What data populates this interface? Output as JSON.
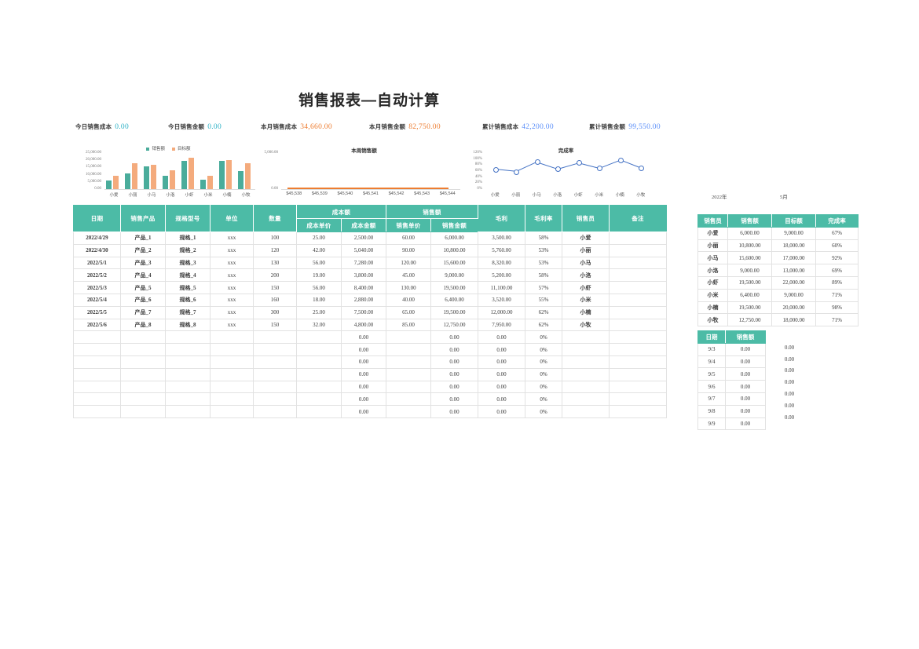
{
  "title": "销售报表—自动计算",
  "kpis": [
    {
      "label": "今日销售成本",
      "value": "0.00",
      "color": "#2ab0c5"
    },
    {
      "label": "今日销售金额",
      "value": "0.00",
      "color": "#2ab0c5"
    },
    {
      "label": "本月销售成本",
      "value": "34,660.00",
      "color": "#ed7d31"
    },
    {
      "label": "本月销售金额",
      "value": "82,750.00",
      "color": "#ed7d31"
    },
    {
      "label": "累计销售成本",
      "value": "42,200.00",
      "color": "#5b8ff9"
    },
    {
      "label": "累计销售金额",
      "value": "99,550.00",
      "color": "#5b8ff9"
    }
  ],
  "period": {
    "year": "2022年",
    "month": "5月"
  },
  "colors": {
    "header_teal": "#4cbba6",
    "series_sales": "#4aac9b",
    "series_target": "#f4ab7d",
    "series_rate": "#4472c4",
    "week_line": "#ed7d31"
  },
  "chart_data": [
    {
      "type": "bar",
      "id": "bar-chart",
      "title": "",
      "legend": [
        "销售额",
        "目标额"
      ],
      "legend_position": "top",
      "categories": [
        "小爱",
        "小丽",
        "小马",
        "小洛",
        "小虾",
        "小米",
        "小楠",
        "小牧"
      ],
      "series": [
        {
          "name": "销售额",
          "values": [
            6000,
            10800,
            15600,
            9000,
            19500,
            6400,
            19500,
            12750
          ]
        },
        {
          "name": "目标额",
          "values": [
            9000,
            18000,
            17000,
            13000,
            22000,
            9000,
            20000,
            18000
          ]
        }
      ],
      "ylim": [
        0,
        25000
      ],
      "yticks": [
        "0.00",
        "5,000.00",
        "10,000.00",
        "15,000.00",
        "20,000.00",
        "25,000.00"
      ],
      "xlabel": "",
      "ylabel": "",
      "grid": false
    },
    {
      "type": "line",
      "id": "week-chart",
      "title": "本周销售额",
      "categories": [
        "$45,538",
        "$45,539",
        "$45,540",
        "$45,541",
        "$45,542",
        "$45,543",
        "$45,544"
      ],
      "series": [
        {
          "name": "本周销售额",
          "values": [
            0,
            0,
            0,
            0,
            0,
            0,
            0
          ]
        }
      ],
      "ylim": [
        0,
        5000
      ],
      "yticks": [
        "0.00",
        "5,000.00"
      ],
      "xlabel": "",
      "ylabel": "",
      "grid": false
    },
    {
      "type": "line",
      "id": "rate-chart",
      "title": "完成率",
      "categories": [
        "小爱",
        "小丽",
        "小马",
        "小洛",
        "小虾",
        "小米",
        "小楠",
        "小牧"
      ],
      "series": [
        {
          "name": "完成率",
          "values": [
            67,
            60,
            92,
            69,
            89,
            71,
            98,
            71
          ]
        }
      ],
      "ylim": [
        0,
        120
      ],
      "yticks": [
        "0%",
        "20%",
        "40%",
        "60%",
        "80%",
        "100%",
        "120%"
      ],
      "xlabel": "",
      "ylabel": "",
      "grid": false
    }
  ],
  "main_table": {
    "header_groups": [
      {
        "label": "日期",
        "rowspan": 2
      },
      {
        "label": "销售产品",
        "rowspan": 2
      },
      {
        "label": "规格型号",
        "rowspan": 2
      },
      {
        "label": "单位",
        "rowspan": 2
      },
      {
        "label": "数量",
        "rowspan": 2
      },
      {
        "label": "成本额",
        "colspan": 2
      },
      {
        "label": "销售额",
        "colspan": 2
      },
      {
        "label": "毛利",
        "rowspan": 2
      },
      {
        "label": "毛利率",
        "rowspan": 2
      },
      {
        "label": "销售员",
        "rowspan": 2
      },
      {
        "label": "备注",
        "rowspan": 2
      }
    ],
    "sub_headers": [
      "成本单价",
      "成本金额",
      "销售单价",
      "销售金额"
    ],
    "rows": [
      {
        "date": "2022/4/29",
        "product": "产品_1",
        "spec": "规格_1",
        "unit": "xxx",
        "qty": "100",
        "cost_price": "25.00",
        "cost_amount": "2,500.00",
        "sale_price": "60.00",
        "sale_amount": "6,000.00",
        "profit": "3,500.00",
        "margin": "58%",
        "salesperson": "小爱",
        "remark": ""
      },
      {
        "date": "2022/4/30",
        "product": "产品_2",
        "spec": "规格_2",
        "unit": "xxx",
        "qty": "120",
        "cost_price": "42.00",
        "cost_amount": "5,040.00",
        "sale_price": "90.00",
        "sale_amount": "10,800.00",
        "profit": "5,760.00",
        "margin": "53%",
        "salesperson": "小丽",
        "remark": ""
      },
      {
        "date": "2022/5/1",
        "product": "产品_3",
        "spec": "规格_3",
        "unit": "xxx",
        "qty": "130",
        "cost_price": "56.00",
        "cost_amount": "7,280.00",
        "sale_price": "120.00",
        "sale_amount": "15,600.00",
        "profit": "8,320.00",
        "margin": "53%",
        "salesperson": "小马",
        "remark": ""
      },
      {
        "date": "2022/5/2",
        "product": "产品_4",
        "spec": "规格_4",
        "unit": "xxx",
        "qty": "200",
        "cost_price": "19.00",
        "cost_amount": "3,800.00",
        "sale_price": "45.00",
        "sale_amount": "9,000.00",
        "profit": "5,200.00",
        "margin": "58%",
        "salesperson": "小洛",
        "remark": ""
      },
      {
        "date": "2022/5/3",
        "product": "产品_5",
        "spec": "规格_5",
        "unit": "xxx",
        "qty": "150",
        "cost_price": "56.00",
        "cost_amount": "8,400.00",
        "sale_price": "130.00",
        "sale_amount": "19,500.00",
        "profit": "11,100.00",
        "margin": "57%",
        "salesperson": "小虾",
        "remark": ""
      },
      {
        "date": "2022/5/4",
        "product": "产品_6",
        "spec": "规格_6",
        "unit": "xxx",
        "qty": "160",
        "cost_price": "18.00",
        "cost_amount": "2,880.00",
        "sale_price": "40.00",
        "sale_amount": "6,400.00",
        "profit": "3,520.00",
        "margin": "55%",
        "salesperson": "小米",
        "remark": ""
      },
      {
        "date": "2022/5/5",
        "product": "产品_7",
        "spec": "规格_7",
        "unit": "xxx",
        "qty": "300",
        "cost_price": "25.00",
        "cost_amount": "7,500.00",
        "sale_price": "65.00",
        "sale_amount": "19,500.00",
        "profit": "12,000.00",
        "margin": "62%",
        "salesperson": "小楠",
        "remark": ""
      },
      {
        "date": "2022/5/6",
        "product": "产品_8",
        "spec": "规格_8",
        "unit": "xxx",
        "qty": "150",
        "cost_price": "32.00",
        "cost_amount": "4,800.00",
        "sale_price": "85.00",
        "sale_amount": "12,750.00",
        "profit": "7,950.00",
        "margin": "62%",
        "salesperson": "小牧",
        "remark": ""
      },
      {
        "date": "",
        "product": "",
        "spec": "",
        "unit": "",
        "qty": "",
        "cost_price": "",
        "cost_amount": "0.00",
        "sale_price": "",
        "sale_amount": "0.00",
        "profit": "0.00",
        "margin": "0%",
        "salesperson": "",
        "remark": ""
      },
      {
        "date": "",
        "product": "",
        "spec": "",
        "unit": "",
        "qty": "",
        "cost_price": "",
        "cost_amount": "0.00",
        "sale_price": "",
        "sale_amount": "0.00",
        "profit": "0.00",
        "margin": "0%",
        "salesperson": "",
        "remark": ""
      },
      {
        "date": "",
        "product": "",
        "spec": "",
        "unit": "",
        "qty": "",
        "cost_price": "",
        "cost_amount": "0.00",
        "sale_price": "",
        "sale_amount": "0.00",
        "profit": "0.00",
        "margin": "0%",
        "salesperson": "",
        "remark": ""
      },
      {
        "date": "",
        "product": "",
        "spec": "",
        "unit": "",
        "qty": "",
        "cost_price": "",
        "cost_amount": "0.00",
        "sale_price": "",
        "sale_amount": "0.00",
        "profit": "0.00",
        "margin": "0%",
        "salesperson": "",
        "remark": ""
      },
      {
        "date": "",
        "product": "",
        "spec": "",
        "unit": "",
        "qty": "",
        "cost_price": "",
        "cost_amount": "0.00",
        "sale_price": "",
        "sale_amount": "0.00",
        "profit": "0.00",
        "margin": "0%",
        "salesperson": "",
        "remark": ""
      },
      {
        "date": "",
        "product": "",
        "spec": "",
        "unit": "",
        "qty": "",
        "cost_price": "",
        "cost_amount": "0.00",
        "sale_price": "",
        "sale_amount": "0.00",
        "profit": "0.00",
        "margin": "0%",
        "salesperson": "",
        "remark": ""
      },
      {
        "date": "",
        "product": "",
        "spec": "",
        "unit": "",
        "qty": "",
        "cost_price": "",
        "cost_amount": "0.00",
        "sale_price": "",
        "sale_amount": "0.00",
        "profit": "0.00",
        "margin": "0%",
        "salesperson": "",
        "remark": ""
      }
    ]
  },
  "salesperson_table": {
    "headers": [
      "销售员",
      "销售额",
      "目标额",
      "完成率"
    ],
    "rows": [
      {
        "name": "小爱",
        "sales": "6,000.00",
        "target": "9,000.00",
        "rate": "67%"
      },
      {
        "name": "小丽",
        "sales": "10,800.00",
        "target": "18,000.00",
        "rate": "60%"
      },
      {
        "name": "小马",
        "sales": "15,600.00",
        "target": "17,000.00",
        "rate": "92%"
      },
      {
        "name": "小洛",
        "sales": "9,000.00",
        "target": "13,000.00",
        "rate": "69%"
      },
      {
        "name": "小虾",
        "sales": "19,500.00",
        "target": "22,000.00",
        "rate": "89%"
      },
      {
        "name": "小米",
        "sales": "6,400.00",
        "target": "9,000.00",
        "rate": "71%"
      },
      {
        "name": "小楠",
        "sales": "19,500.00",
        "target": "20,000.00",
        "rate": "98%"
      },
      {
        "name": "小牧",
        "sales": "12,750.00",
        "target": "18,000.00",
        "rate": "71%"
      }
    ]
  },
  "daily_table": {
    "headers": [
      "日期",
      "销售额"
    ],
    "rows": [
      {
        "date": "9/3",
        "sales": "0.00",
        "extra": "0.00"
      },
      {
        "date": "9/4",
        "sales": "0.00",
        "extra": "0.00"
      },
      {
        "date": "9/5",
        "sales": "0.00",
        "extra": "0.00"
      },
      {
        "date": "9/6",
        "sales": "0.00",
        "extra": "0.00"
      },
      {
        "date": "9/7",
        "sales": "0.00",
        "extra": "0.00"
      },
      {
        "date": "9/8",
        "sales": "0.00",
        "extra": "0.00"
      },
      {
        "date": "9/9",
        "sales": "0.00",
        "extra": "0.00"
      }
    ]
  }
}
